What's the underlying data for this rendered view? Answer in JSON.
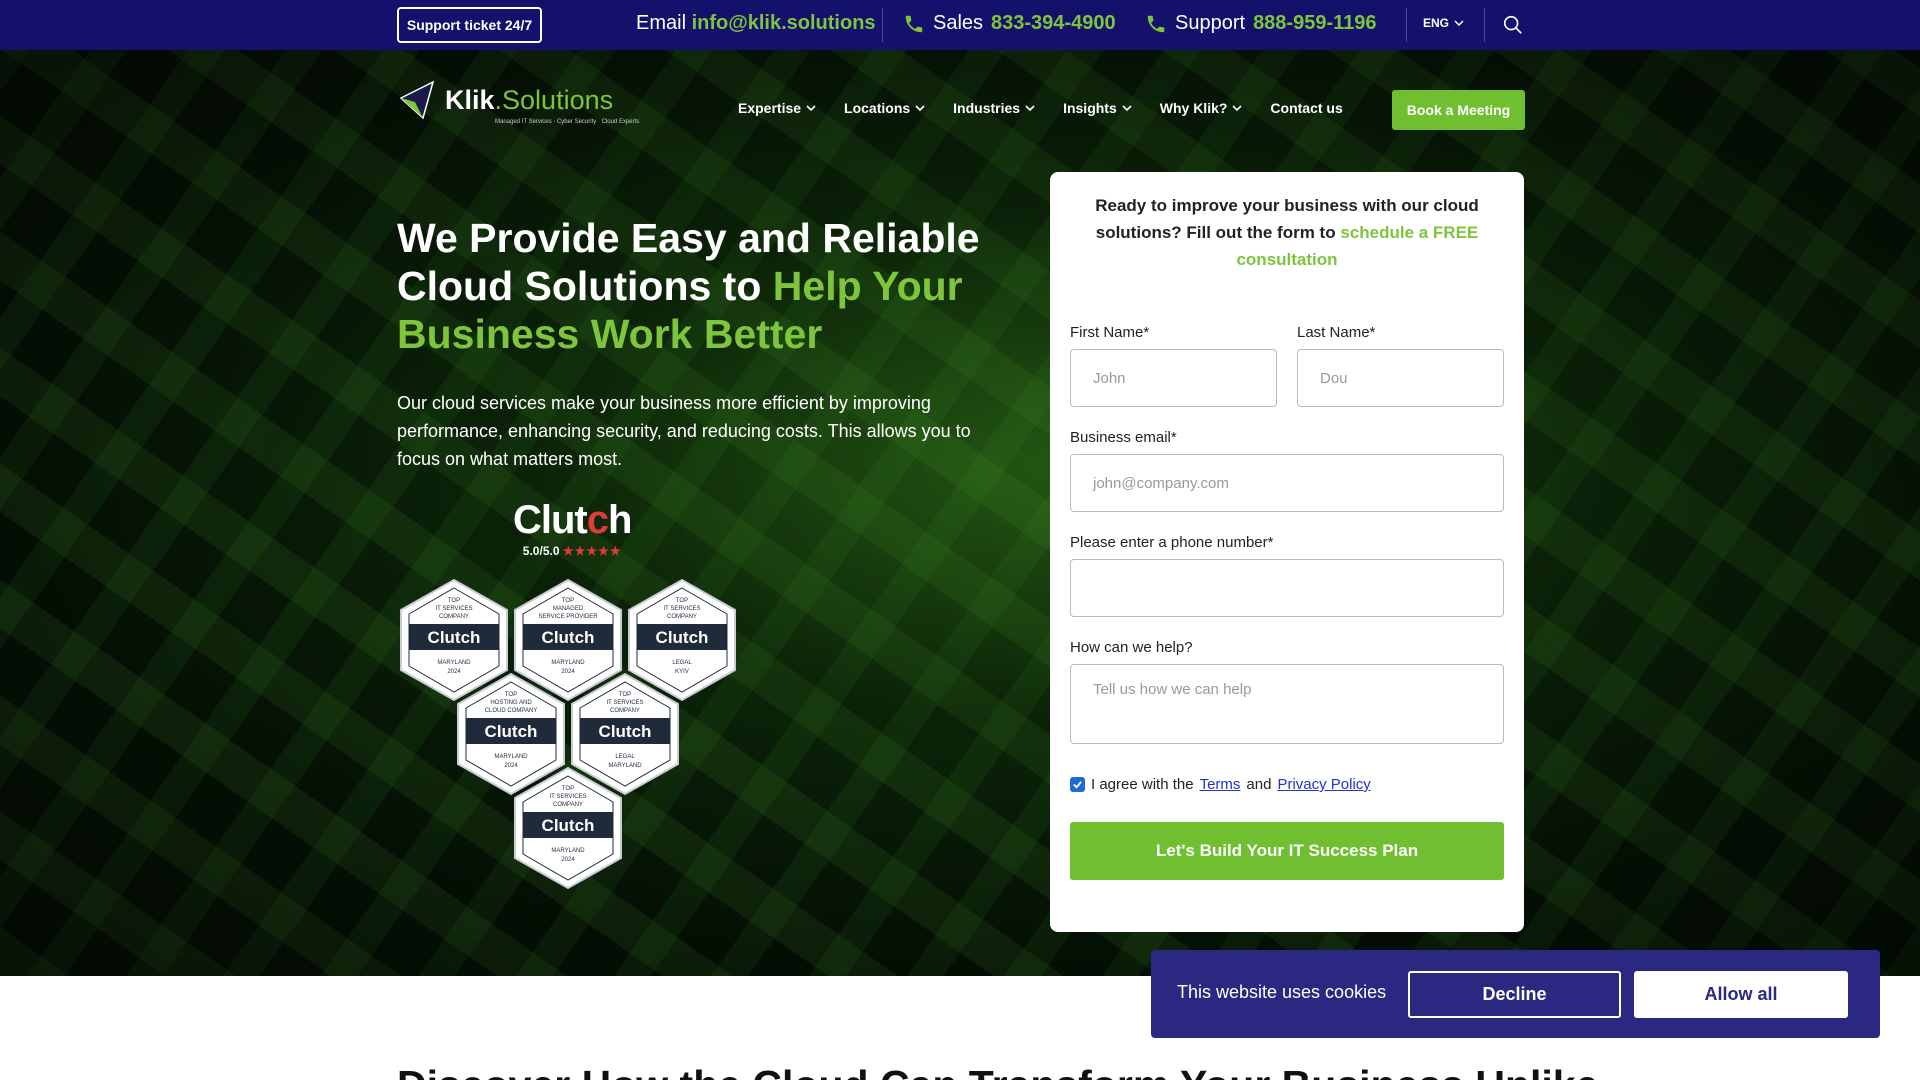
{
  "topbar": {
    "support_label": "Support ticket 24/7",
    "email_prefix": "Email",
    "email_value": "info@klik.solutions",
    "sales_prefix": "Sales",
    "sales_value": "833-394-4900",
    "support_prefix": "Support",
    "support_value": "888-959-1196",
    "language": "ENG"
  },
  "brand": {
    "name_main": "Klik",
    "name_accent": ".Solutions",
    "tagline": "Managed IT Services · Cyber Security · Cloud Experts"
  },
  "nav": {
    "items": [
      {
        "label": "Expertise"
      },
      {
        "label": "Locations"
      },
      {
        "label": "Industries"
      },
      {
        "label": "Insights"
      },
      {
        "label": "Why Klik?"
      },
      {
        "label": "Contact us"
      }
    ],
    "cta": "Book a Meeting"
  },
  "hero": {
    "title_line1": "We Provide Easy and Reliable",
    "title_line2_plain": "Cloud Solutions to ",
    "title_line2_accent": "Help Your",
    "title_line3_accent": "Business Work Better",
    "description": "Our cloud services make your business more efficient by improving performance, enhancing security, and reducing costs. This allows you to focus on what matters most."
  },
  "clutch": {
    "wordmark": "Clutch",
    "rating": "5.0/5.0",
    "stars": "★★★★★",
    "badges": [
      {
        "top": "TOP",
        "cat": "IT SERVICES",
        "cat2": "COMPANY",
        "brand": "Clutch",
        "loc": "MARYLAND",
        "year": "2024"
      },
      {
        "top": "TOP",
        "cat": "MANAGED",
        "cat2": "SERVICE PROVIDER",
        "brand": "Clutch",
        "loc": "MARYLAND",
        "year": "2024"
      },
      {
        "top": "TOP",
        "cat": "IT SERVICES",
        "cat2": "COMPANY",
        "brand": "Clutch",
        "loc": "LEGAL",
        "year": "KYIV"
      },
      {
        "top": "TOP",
        "cat": "HOSTING AND",
        "cat2": "CLOUD COMPANY",
        "brand": "Clutch",
        "loc": "MARYLAND",
        "year": "2024"
      },
      {
        "top": "TOP",
        "cat": "IT SERVICES",
        "cat2": "COMPANY",
        "brand": "Clutch",
        "loc": "LEGAL",
        "year": "MARYLAND"
      },
      {
        "top": "TOP",
        "cat": "IT SERVICES",
        "cat2": "COMPANY",
        "brand": "Clutch",
        "loc": "MARYLAND",
        "year": "2024"
      }
    ]
  },
  "form": {
    "intro_plain": "Ready to improve your business with our cloud solutions? Fill out the form to ",
    "intro_accent": "schedule a FREE consultation",
    "first_name_label": "First Name*",
    "first_name_placeholder": "John",
    "last_name_label": "Last Name*",
    "last_name_placeholder": "Dou",
    "email_label": "Business email*",
    "email_placeholder": "john@company.com",
    "phone_label": "Please enter a phone number*",
    "phone_placeholder": "",
    "help_label": "How can we help?",
    "help_placeholder": "Tell us how we can help",
    "agree_prefix": "I agree with the",
    "terms": "Terms",
    "and": "and",
    "privacy": "Privacy Policy",
    "submit": "Let's Build Your IT Success Plan"
  },
  "below": {
    "title": "Discover How the Cloud Can Transform Your Business Unlike"
  },
  "cookie": {
    "text": "This website uses cookies",
    "decline": "Decline",
    "allow": "Allow all"
  },
  "colors": {
    "topbar_bg": "#13116b",
    "accent_green": "#7ec43c",
    "cookie_bg": "#2a2880"
  }
}
